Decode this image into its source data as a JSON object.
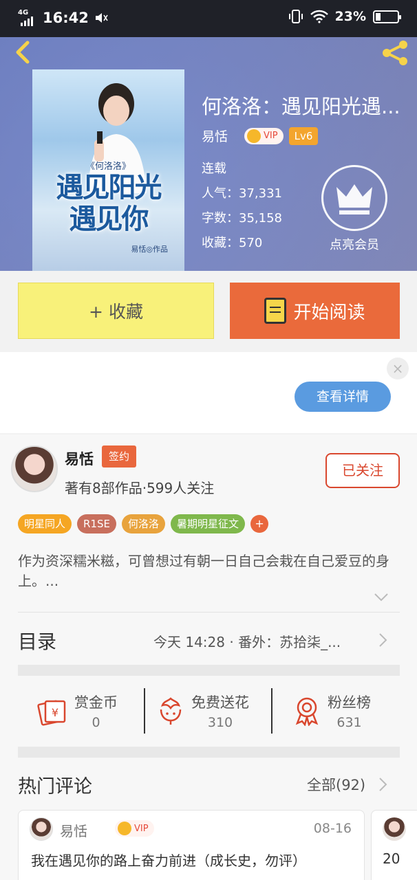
{
  "status_bar": {
    "network": "4G",
    "network_sup": "HD",
    "time": "16:42",
    "battery": "23%"
  },
  "book": {
    "title": "何洛洛：遇见阳光遇...",
    "author": "易恬",
    "vip": "VIP",
    "level": "Lv6",
    "status": "连载",
    "popularity": "人气：37,331",
    "word_count": "字数：35,158",
    "favorites": "收藏：570",
    "member_label": "点亮会员",
    "cover": {
      "subtitle": "《何洛洛》",
      "line1": "遇见阳光",
      "line2": "遇见你",
      "author_line": "易恬◎作品"
    }
  },
  "actions": {
    "collect": "+ 收藏",
    "read": "开始阅读"
  },
  "ad": {
    "close": "×",
    "detail_button": "查看详情"
  },
  "author_card": {
    "name": "易恬",
    "sign_tag": "签约",
    "stats": "著有8部作品·599人关注",
    "follow": "已关注"
  },
  "tags": [
    {
      "label": "明星同人",
      "color": "#f5a623"
    },
    {
      "label": "R1SE",
      "color": "#c86f5d"
    },
    {
      "label": "何洛洛",
      "color": "#e8a33d"
    },
    {
      "label": "暑期明星征文",
      "color": "#7fb84c"
    }
  ],
  "tag_more": "+",
  "description": "作为资深糯米糍，可曾想过有朝一日自己会栽在自己爱豆的身上。...",
  "toc": {
    "label": "目录",
    "latest": "今天 14:28 · 番外：苏拾柒_..."
  },
  "rewards": [
    {
      "label": "赏金币",
      "value": "0"
    },
    {
      "label": "免费送花",
      "value": "310"
    },
    {
      "label": "粉丝榜",
      "value": "631"
    }
  ],
  "comments": {
    "label": "热门评论",
    "all": "全部(92)",
    "items": [
      {
        "user": "易恬",
        "vip": "VIP",
        "date": "08-16",
        "text": "我在遇见你的路上奋力前进（成长史，勿评）"
      },
      {
        "text": "20"
      }
    ]
  },
  "colors": {
    "accent": "#ea6a3b",
    "collect": "#f8f17a",
    "header": "#7a86bd",
    "ad_button": "#5a9be0"
  }
}
